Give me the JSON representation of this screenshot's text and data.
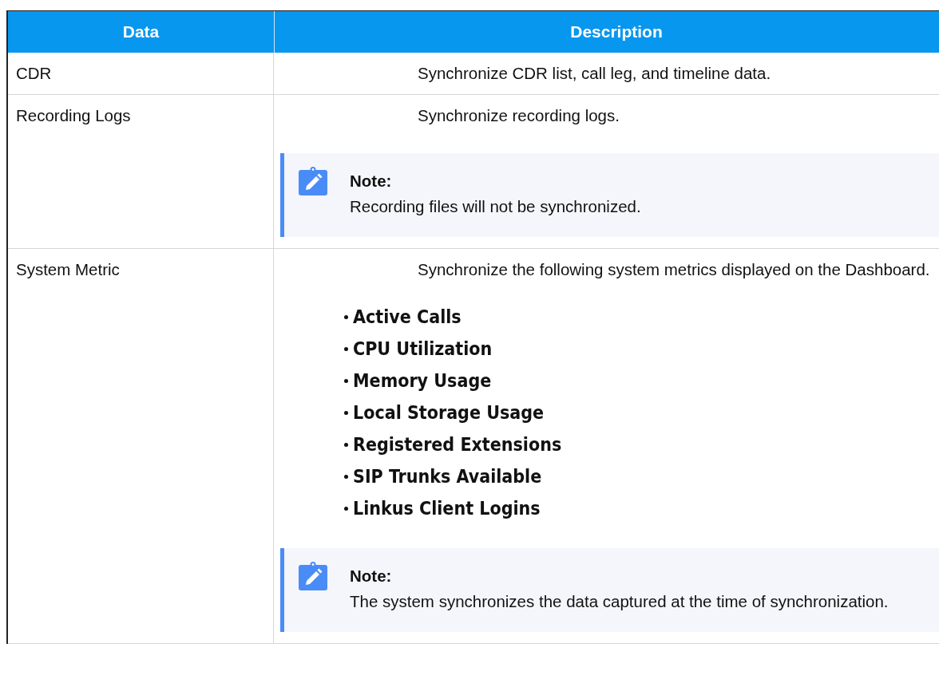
{
  "table": {
    "columns": [
      "Data",
      "Description"
    ],
    "rows": [
      {
        "data": "CDR",
        "description": "Synchronize CDR list, call leg, and timeline data."
      },
      {
        "data": "Recording Logs",
        "description": "Synchronize recording logs.",
        "note": {
          "title": "Note:",
          "text": "Recording files will not be synchronized."
        }
      },
      {
        "data": "System Metric",
        "description": "Synchronize the following system metrics displayed on the Dashboard.",
        "bullets": [
          "Active Calls",
          "CPU Utilization",
          "Memory Usage",
          "Local Storage Usage",
          "Registered Extensions",
          "SIP Trunks Available",
          "Linkus Client Logins"
        ],
        "note": {
          "title": "Note:",
          "text": "The system synchronizes the data captured at the time of synchronization."
        }
      }
    ]
  }
}
